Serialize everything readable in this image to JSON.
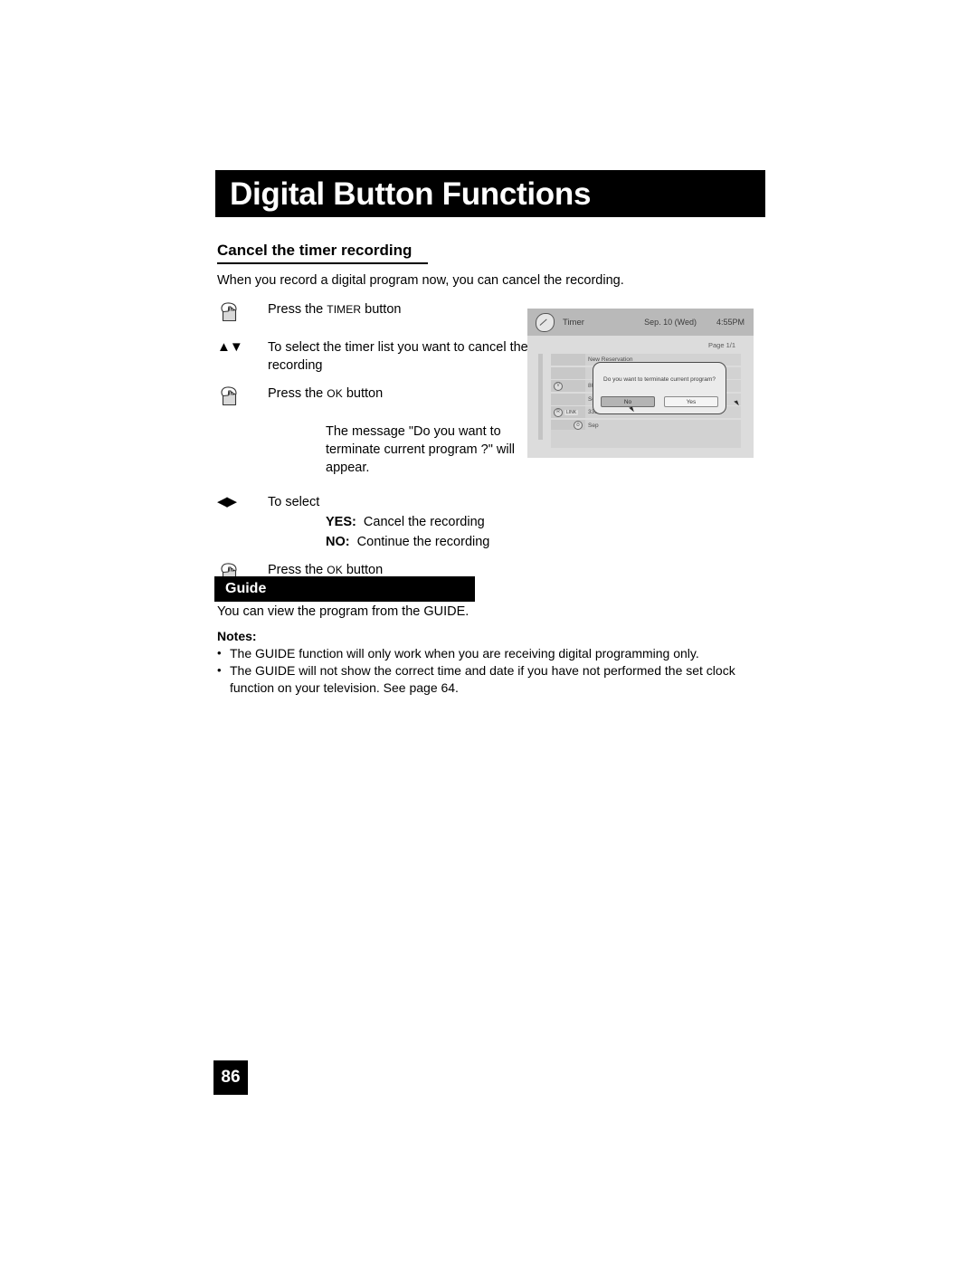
{
  "header": {
    "chapter_title": "Digital Button Functions"
  },
  "section": {
    "heading": "Cancel the timer recording",
    "intro": "When you record a digital program now, you can cancel the recording."
  },
  "steps": {
    "step1": {
      "icon": "hand-press-icon",
      "prefix": "Press the ",
      "key": "Timer",
      "suffix": " button"
    },
    "step2": {
      "icon": "up-down-arrows-icon",
      "glyphs": "▲▼",
      "text": "To select the timer list you want to cancel the recording"
    },
    "step3": {
      "icon": "hand-press-icon",
      "prefix": "Press the ",
      "key": "Ok",
      "suffix": " button"
    },
    "note": "The message \"Do you want to terminate current program ?\" will appear.",
    "step4": {
      "icon": "left-right-arrows-icon",
      "glyphs": "◀▶",
      "text": "To select"
    },
    "yes_label": "YES:",
    "yes_text": "Cancel the recording",
    "no_label": "NO:",
    "no_text": "Continue the recording",
    "step5": {
      "icon": "hand-press-icon",
      "prefix": "Press the ",
      "key": "Ok",
      "suffix": " button"
    }
  },
  "tv_screen": {
    "header_icon": "clock-icon",
    "header_title": "Timer",
    "header_date": "Sep. 10 (Wed)",
    "header_time": "4:55PM",
    "page_indicator": "Page 1/1",
    "rows": [
      {
        "icon": "",
        "badge": "",
        "text": "New Reservation"
      },
      {
        "icon": "",
        "badge": "",
        "text": ""
      },
      {
        "icon": "V",
        "badge": "",
        "text": "80-3"
      },
      {
        "icon": "",
        "badge": "",
        "text": "Sep"
      },
      {
        "icon": "R",
        "badge": "LINK",
        "text": "335"
      },
      {
        "icon": "clock",
        "badge": "",
        "text": "Sep"
      }
    ],
    "dialog": {
      "message": "Do you want to terminate current program?",
      "button_no": "No",
      "button_yes": "Yes"
    }
  },
  "guide": {
    "bar_label": "Guide",
    "description": "You can view the program from the GUIDE.",
    "notes_title": "Notes:",
    "notes": [
      "The GUIDE function will only work when you are receiving digital programming only.",
      "The GUIDE will not show the correct time and date if you have not performed the set clock function on your television.  See page 64."
    ]
  },
  "footer": {
    "page_number": "86"
  }
}
